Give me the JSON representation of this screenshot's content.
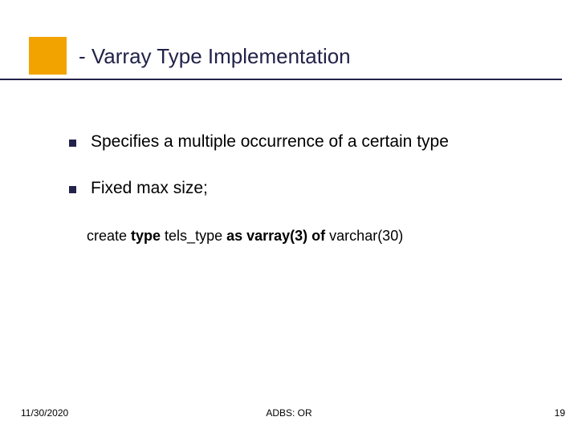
{
  "title": "- Varray Type Implementation",
  "bullets": [
    "Specifies a multiple occurrence of a certain type",
    "Fixed max size;"
  ],
  "code": {
    "parts": [
      {
        "t": "create ",
        "b": false
      },
      {
        "t": "type ",
        "b": true
      },
      {
        "t": "tels_type ",
        "b": false
      },
      {
        "t": "as varray(3) of ",
        "b": true
      },
      {
        "t": "varchar(30)",
        "b": false
      }
    ]
  },
  "footer": {
    "date": "11/30/2020",
    "center": "ADBS: OR",
    "page": "19"
  }
}
